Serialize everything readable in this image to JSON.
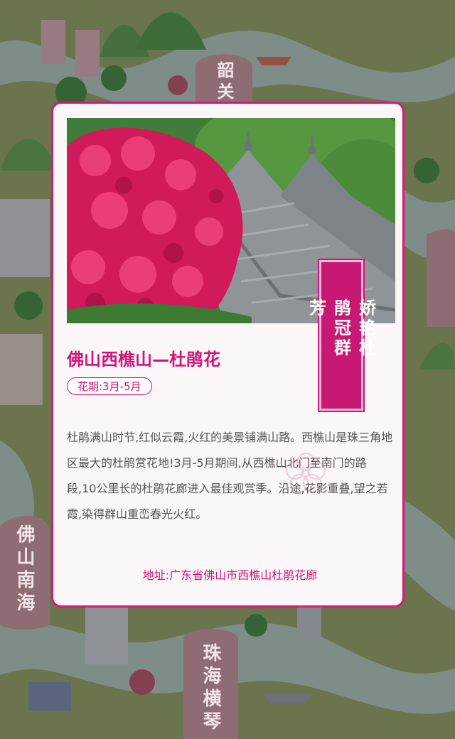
{
  "map_labels": {
    "shaoguan": "韶关",
    "foshan_nanhai": "佛山南海",
    "zhuhai_hengqin": "珠海横琴"
  },
  "card": {
    "ribbon_text": "娇艳杜鹃冠群芳",
    "title": "佛山西樵山—杜鹃花",
    "flower_period": "花期:3月-5月",
    "description": "杜鹃满山时节,红似云霞,火红的美景铺满山路。西樵山是珠三角地区最大的杜鹃赏花地!3月-5月期间,从西樵山北门至南门的路段,10公里长的杜鹃花廊进入最佳观赏季。沿途,花影重叠,望之若霞,染得群山重峦春光火红。",
    "address": "地址:广东省佛山市西樵山杜鹃花廊"
  },
  "colors": {
    "accent": "#d0157a",
    "card_bg": "#fbf6f8",
    "ribbon": "#c71873"
  },
  "icons": [
    "flower-watermark-icon"
  ]
}
